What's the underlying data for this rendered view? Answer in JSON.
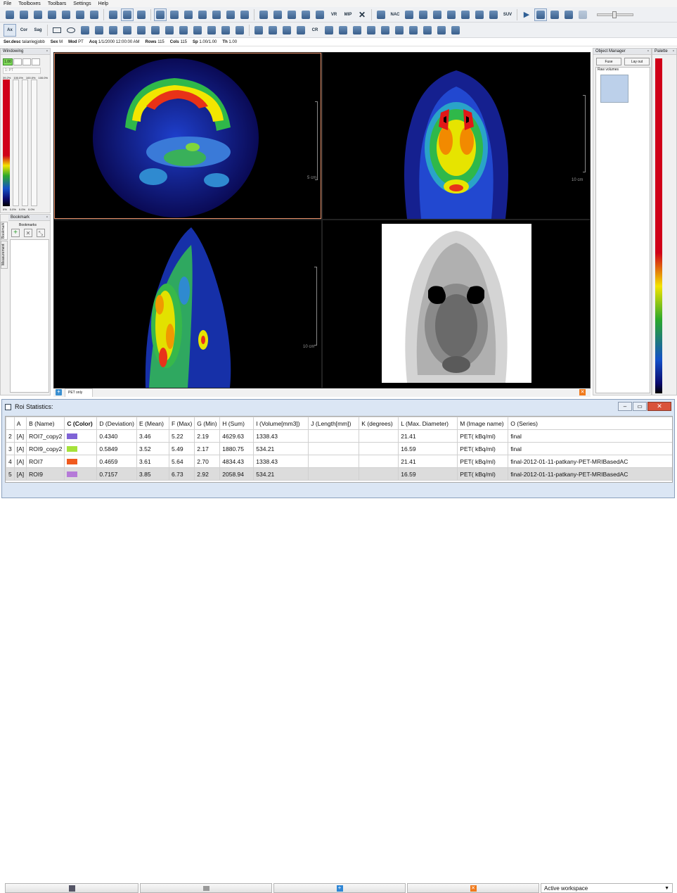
{
  "menu": [
    "File",
    "Toolboxes",
    "Toolbars",
    "Settings",
    "Help"
  ],
  "toolbar2": {
    "ax": "Ax",
    "cor": "Cor",
    "sag": "Sag",
    "cr": "CR"
  },
  "toolbar1": {
    "vr": "VR",
    "mip": "MIP",
    "nac": "NAC",
    "suv": "SUV"
  },
  "info": [
    {
      "k": "Ser.desc",
      "v": "talanlegjobb"
    },
    {
      "k": "Sex",
      "v": "M"
    },
    {
      "k": "Mod",
      "v": "PT"
    },
    {
      "k": "Acq",
      "v": "1/1/2000 12:00:00 AM"
    },
    {
      "k": "Rows",
      "v": "115"
    },
    {
      "k": "Cols",
      "v": "115"
    },
    {
      "k": "Sp",
      "v": "1.00/1.00"
    },
    {
      "k": "Th",
      "v": "1.00"
    }
  ],
  "windowing": {
    "title": "Windowing",
    "value": "1.00",
    "layer": "1: PT",
    "top_pct": "39.2%",
    "col_pct": [
      "100.0%",
      "100.0%",
      "100.0%"
    ],
    "bottom": "0%",
    "bottom_cols": [
      "0.0%",
      "0.0%",
      "0.0%"
    ]
  },
  "bookmarks": {
    "title": "Bookmark",
    "header": "Bookmarks",
    "tabs": [
      "Bookmark",
      "Measurement"
    ]
  },
  "object_manager": {
    "title": "Object Manager",
    "fuse": "Fuse",
    "layout": "Lay out",
    "raw": "Raw volumes"
  },
  "palette": {
    "title": "Palette"
  },
  "scales": {
    "axial": "5 cm",
    "coronal": "10 cm",
    "sagittal": "10 cm"
  },
  "tab": {
    "label": "PET only"
  },
  "roi": {
    "title": "Roi Statistics:",
    "columns": [
      "",
      "A",
      "B (Name)",
      "C (Color)",
      "D (Deviation)",
      "E (Mean)",
      "F (Max)",
      "G (Min)",
      "H (Sum)",
      "I (Volume[mm3])",
      "J (Length[mm])",
      "K (degrees)",
      "L (Max. Diameter)",
      "M (Image name)",
      "O (Series)"
    ],
    "rows": [
      {
        "n": "2",
        "a": "[A]",
        "name": "ROI7_copy2",
        "color": "#7f63d6",
        "dev": "0.4340",
        "mean": "3.46",
        "max": "5.22",
        "min": "2.19",
        "sum": "4629.63",
        "vol": "1338.43",
        "len": "",
        "deg": "",
        "diam": "21.41",
        "img": "PET( kBq/ml)",
        "series": "final"
      },
      {
        "n": "3",
        "a": "[A]",
        "name": "ROI9_copy2",
        "color": "#a6e23a",
        "dev": "0.5849",
        "mean": "3.52",
        "max": "5.49",
        "min": "2.17",
        "sum": "1880.75",
        "vol": "534.21",
        "len": "",
        "deg": "",
        "diam": "16.59",
        "img": "PET( kBq/ml)",
        "series": "final"
      },
      {
        "n": "4",
        "a": "[A]",
        "name": "ROI7",
        "color": "#f05a1e",
        "dev": "0.4659",
        "mean": "3.61",
        "max": "5.64",
        "min": "2.70",
        "sum": "4834.43",
        "vol": "1338.43",
        "len": "",
        "deg": "",
        "diam": "21.41",
        "img": "PET( kBq/ml)",
        "series": "final-2012-01-11-patkany-PET-MRIBasedAC"
      },
      {
        "n": "5",
        "a": "[A]",
        "name": "ROI9",
        "color": "#b57ad8",
        "dev": "0.7157",
        "mean": "3.85",
        "max": "6.73",
        "min": "2.92",
        "sum": "2058.94",
        "vol": "534.21",
        "len": "",
        "deg": "",
        "diam": "16.59",
        "img": "PET( kBq/ml)",
        "series": "final-2012-01-11-patkany-PET-MRIBasedAC"
      }
    ],
    "workspace": "Active workspace"
  }
}
